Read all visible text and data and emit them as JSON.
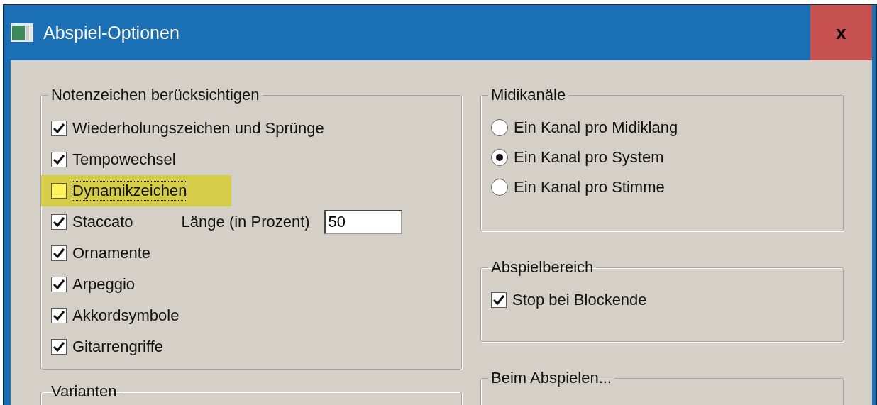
{
  "window": {
    "title": "Abspiel-Optionen",
    "close_label": "x"
  },
  "left_groups": [
    {
      "title": "Notenzeichen berücksichtigen",
      "items": [
        {
          "label": "Wiederholungszeichen und Sprünge",
          "checked": true,
          "highlighted": false,
          "focused": false
        },
        {
          "label": "Tempowechsel",
          "checked": true,
          "highlighted": false,
          "focused": false
        },
        {
          "label": "Dynamikzeichen",
          "checked": false,
          "highlighted": true,
          "focused": true
        },
        {
          "label": "Staccato",
          "checked": true,
          "highlighted": false,
          "focused": false,
          "field": {
            "label": "Länge (in Prozent)",
            "value": "50"
          }
        },
        {
          "label": "Ornamente",
          "checked": true,
          "highlighted": false,
          "focused": false
        },
        {
          "label": "Arpeggio",
          "checked": true,
          "highlighted": false,
          "focused": false
        },
        {
          "label": "Akkordsymbole",
          "checked": true,
          "highlighted": false,
          "focused": false
        },
        {
          "label": "Gitarrengriffe",
          "checked": true,
          "highlighted": false,
          "focused": false
        }
      ]
    },
    {
      "title": "Varianten"
    }
  ],
  "right_groups": [
    {
      "title": "Midikanäle",
      "kind": "radio",
      "items": [
        {
          "label": "Ein Kanal pro Midiklang",
          "selected": false
        },
        {
          "label": "Ein Kanal pro System",
          "selected": true
        },
        {
          "label": "Ein Kanal pro Stimme",
          "selected": false
        }
      ]
    },
    {
      "title": "Abspielbereich",
      "kind": "checkbox",
      "items": [
        {
          "label": "Stop bei Blockende",
          "checked": true
        }
      ]
    },
    {
      "title": "Beim Abspielen..."
    }
  ]
}
